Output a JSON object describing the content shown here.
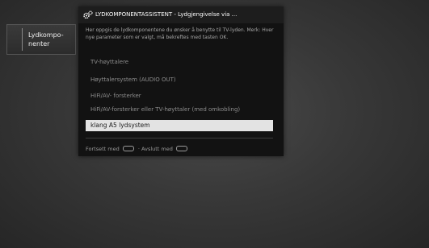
{
  "side_tab": {
    "label": "Lydkompo-\nnenter",
    "icon": "arrow-left-icon"
  },
  "dialog": {
    "icon": "gear-icon",
    "title": "LYDKOMPONENTASSISTENT - Lydgjengivelse via ...",
    "description": "Her oppgis de lydkomponentene du ønsker å benytte til TV-lyden. Merk: Hver nye parameter som er valgt, må bekreftes med tasten OK.",
    "options": [
      "TV-høyttalere",
      "Høyttalersystem (AUDIO OUT)",
      "HiFi/AV- forsterker",
      "HiFi/AV-forsterker eller TV-høyttaler (med omkobling)",
      "klang A5 lydsystem"
    ],
    "selected_index": 4,
    "footer": {
      "continue_label": "Fortsett med",
      "continue_key_icon": "ok-key-icon",
      "exit_label": "Avslutt med",
      "exit_key_icon": "end-key-icon"
    }
  }
}
